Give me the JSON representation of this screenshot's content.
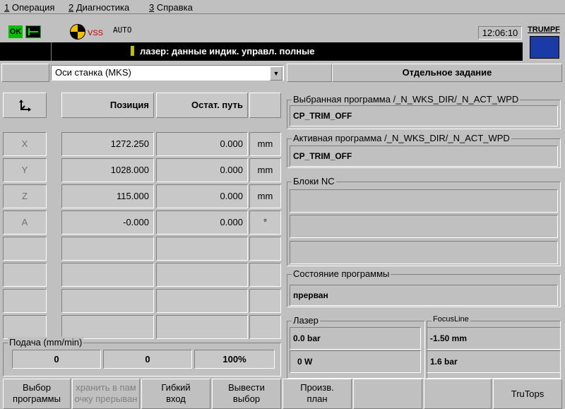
{
  "menu": [
    {
      "key": "1",
      "label": "Операция"
    },
    {
      "key": "2",
      "label": "Диагностика"
    },
    {
      "key": "3",
      "label": "Справка"
    }
  ],
  "status": {
    "ok_label": "OK",
    "vss_label": "VSS",
    "mode_label": "AUTO",
    "clock": "12:06:10",
    "brand": "TRUMPF"
  },
  "alarm_message": "лазер: данные индик. управл. полные",
  "axes_selector": {
    "value": "Оси станка (MKS)",
    "arrow": "▼"
  },
  "task_title": "Отдельное задание",
  "axes_table": {
    "headers": {
      "position": "Позиция",
      "remaining": "Остат. путь"
    },
    "rows": [
      {
        "axis": "X",
        "position": "1272.250",
        "remaining": "0.000",
        "unit": "mm"
      },
      {
        "axis": "Y",
        "position": "1028.000",
        "remaining": "0.000",
        "unit": "mm"
      },
      {
        "axis": "Z",
        "position": "115.000",
        "remaining": "0.000",
        "unit": "mm"
      },
      {
        "axis": "A",
        "position": "-0.000",
        "remaining": "0.000",
        "unit": "°"
      }
    ]
  },
  "feed": {
    "title": "Подача (mm/min)",
    "value1": "0",
    "value2": "0",
    "percent": "100%"
  },
  "selected_program": {
    "title": "Выбранная программа /_N_WKS_DIR/_N_ACT_WPD",
    "value": "CP_TRIM_OFF"
  },
  "active_program": {
    "title": "Активная программа /_N_WKS_DIR/_N_ACT_WPD",
    "value": "CP_TRIM_OFF"
  },
  "nc_blocks": {
    "title": "Блоки NC"
  },
  "program_state": {
    "title": "Состояние программы",
    "value": "прерван"
  },
  "laser": {
    "title": "Лазер",
    "pressure": "0.0 bar",
    "power": "0 W"
  },
  "focusline": {
    "title": "FocusLine",
    "position": "-1.50 mm",
    "pressure": "1.6 bar"
  },
  "softkeys": [
    {
      "line1": "Выбор",
      "line2": "программы",
      "enabled": true
    },
    {
      "line1": "хранить в пам",
      "line2": "очку прерыван",
      "enabled": false
    },
    {
      "line1": "Гибкий",
      "line2": "вход",
      "enabled": true
    },
    {
      "line1": "Вывести",
      "line2": "выбор",
      "enabled": true
    },
    {
      "line1": "Произв.",
      "line2": "план",
      "enabled": true
    },
    {
      "line1": "",
      "line2": "",
      "enabled": true
    },
    {
      "line1": "",
      "line2": "",
      "enabled": true
    },
    {
      "line1": "TruTops",
      "line2": "",
      "enabled": true
    }
  ],
  "colors": {
    "background": "#c0c0c0",
    "alarm_bg": "#000000",
    "ok_green": "#00c000",
    "brand_blue": "#1a3aa8",
    "vss_red": "#c00000"
  }
}
